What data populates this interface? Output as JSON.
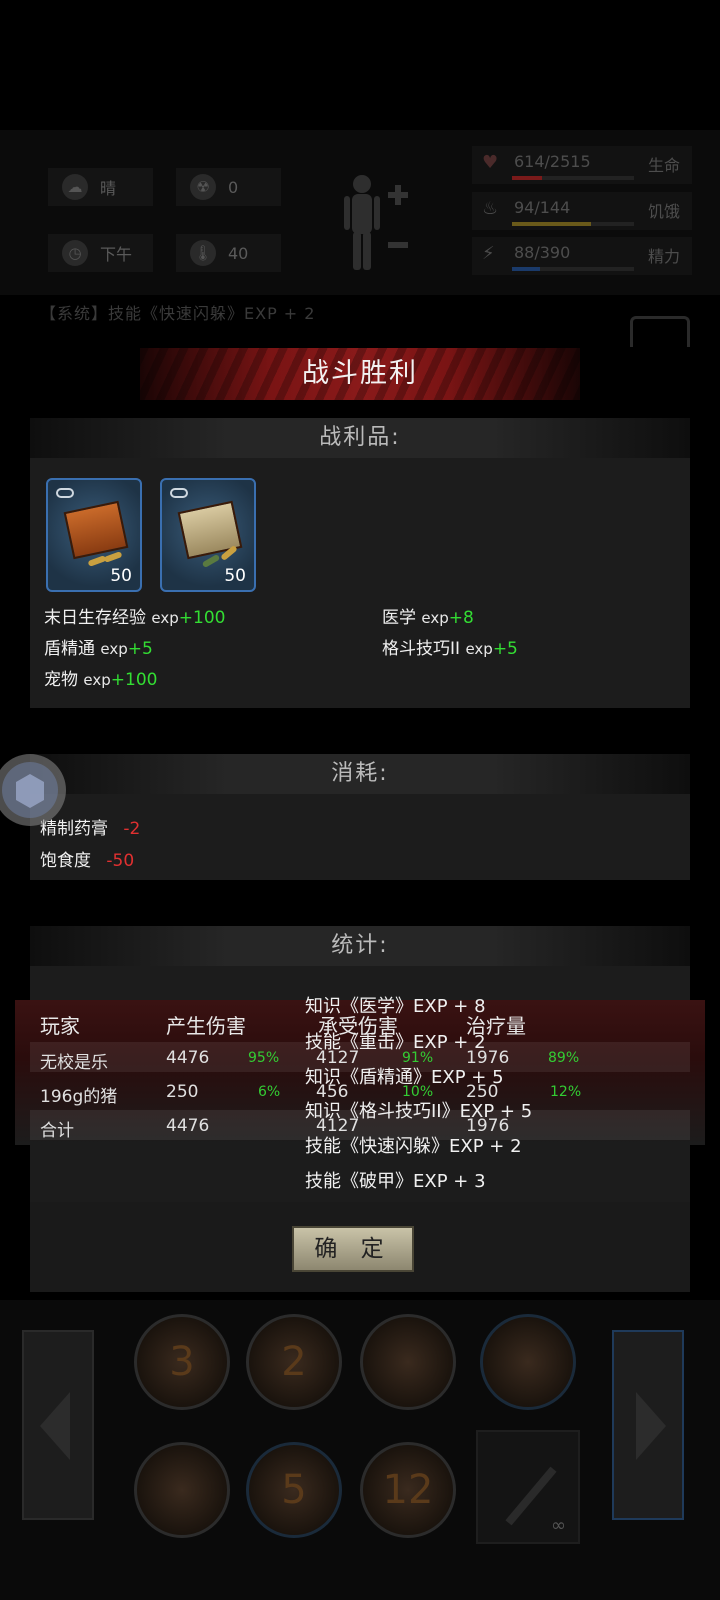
{
  "hud": {
    "weather": "晴",
    "radiation": "0",
    "time_of_day": "下午",
    "temperature": "40",
    "life": {
      "value": "614/2515",
      "label": "生命",
      "ratio": 0.244,
      "color": "#7a1a1a"
    },
    "hunger": {
      "value": "94/144",
      "label": "饥饿",
      "ratio": 0.65,
      "color": "#6a5a1a"
    },
    "energy": {
      "value": "88/390",
      "label": "精力",
      "ratio": 0.226,
      "color": "#1a3a6a"
    }
  },
  "background_log": "【系统】技能《快速闪躲》EXP + 2",
  "modal": {
    "title": "战斗胜利",
    "loot_header": "战利品:",
    "loot_items": [
      {
        "icon": "ammo-box-icon",
        "qty": "50"
      },
      {
        "icon": "ammo-crate-icon",
        "qty": "50"
      }
    ],
    "exp_gains": [
      {
        "name": "末日生存经验",
        "unit": "exp",
        "value": "+100"
      },
      {
        "name": "医学",
        "unit": "exp",
        "value": "+8"
      },
      {
        "name": "盾精通",
        "unit": "exp",
        "value": "+5"
      },
      {
        "name": "格斗技巧II",
        "unit": "exp",
        "value": "+5"
      },
      {
        "name": "宠物",
        "unit": "exp",
        "value": "+100"
      }
    ],
    "consume_header": "消耗:",
    "consumption": [
      {
        "name": "精制药膏",
        "value": "-2"
      },
      {
        "name": "饱食度",
        "value": "-50"
      }
    ],
    "stats_header": "统计:",
    "stats_columns": [
      "玩家",
      "产生伤害",
      "承受伤害",
      "治疗量"
    ],
    "stats_rows": [
      {
        "player": "无校是乐",
        "dmg": "4476",
        "dmg_pct": "95%",
        "taken": "4127",
        "taken_pct": "91%",
        "heal": "1976",
        "heal_pct": "89%"
      },
      {
        "player": "196g的猪",
        "dmg": "250",
        "dmg_pct": "6%",
        "taken": "456",
        "taken_pct": "10%",
        "heal": "250",
        "heal_pct": "12%"
      },
      {
        "player": "合计",
        "dmg": "4476",
        "dmg_pct": "",
        "taken": "4127",
        "taken_pct": "",
        "heal": "1976",
        "heal_pct": ""
      }
    ],
    "log_overlay": [
      "知识《医学》EXP + 8",
      "技能《重击》EXP + 2",
      "知识《盾精通》EXP + 5",
      "知识《格斗技巧II》EXP + 5",
      "技能《快速闪躲》EXP + 2",
      "技能《破甲》EXP + 3"
    ],
    "confirm_label": "确 定"
  },
  "skillbar": {
    "top": [
      "3",
      "2",
      "",
      ""
    ],
    "bottom": [
      "",
      "5",
      "12"
    ],
    "weapon_count": "∞"
  }
}
